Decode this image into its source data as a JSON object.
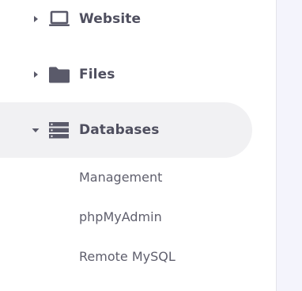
{
  "nav": {
    "website": {
      "label": "Website",
      "icon": "laptop-icon"
    },
    "files": {
      "label": "Files",
      "icon": "folder-icon"
    },
    "databases": {
      "label": "Databases",
      "icon": "database-icon",
      "expanded": true,
      "children": [
        "Management",
        "phpMyAdmin",
        "Remote MySQL"
      ]
    }
  },
  "colors": {
    "sidebar_bg": "#ffffff",
    "active_bg": "#f1f1f3",
    "label": "#4f4f5f",
    "icon": "#5a5a6a",
    "content_bg": "#f4f4fc"
  }
}
